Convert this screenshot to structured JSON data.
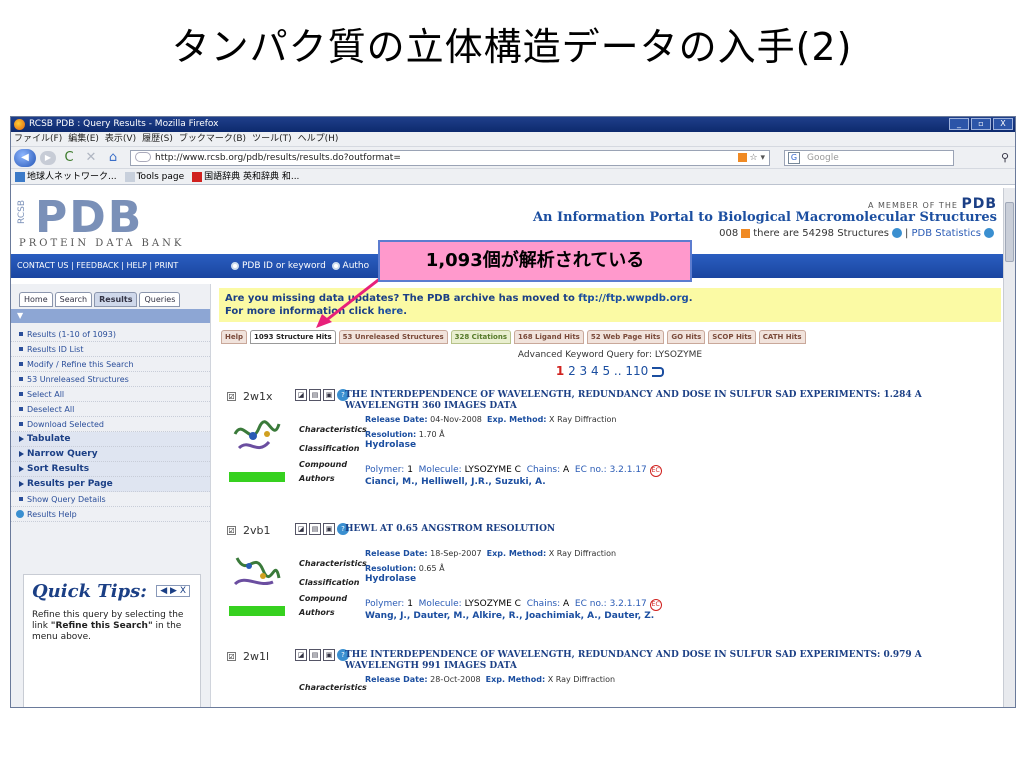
{
  "slide": {
    "title": "タンパク質の立体構造データの入手(2)"
  },
  "browser": {
    "window_title": "RCSB PDB : Query Results - Mozilla Firefox",
    "menu": [
      "ファイル(F)",
      "編集(E)",
      "表示(V)",
      "履歴(S)",
      "ブックマーク(B)",
      "ツール(T)",
      "ヘルプ(H)"
    ],
    "url": "http://www.rcsb.org/pdb/results/results.do?outformat=",
    "search_placeholder": "Google",
    "bookmarks": [
      "地球人ネットワーク...",
      "Tools page",
      "国語辞典 英和辞典 和..."
    ],
    "window_controls": [
      "_",
      "▫",
      "X"
    ]
  },
  "header": {
    "logo_big": "PDB",
    "logo_rcsb": "RCSB",
    "logo_sub": "PROTEIN DATA BANK",
    "member": "A MEMBER OF THE",
    "member_brand": "PDB",
    "portal": "An Information Portal to Biological Macromolecular Structures",
    "stats_date": "008",
    "stats_text": "there are 54298 Structures",
    "stats_sep": "|",
    "stats_link": "PDB Statistics"
  },
  "topnav": {
    "links": "CONTACT US | FEEDBACK | HELP | PRINT",
    "radio1": "PDB ID or keyword",
    "radio2": "Autho"
  },
  "sidebar": {
    "tabs": [
      "Home",
      "Search",
      "Results",
      "Queries"
    ],
    "items": [
      "Results (1-10 of 1093)",
      "Results ID List",
      "Modify / Refine this Search",
      "53 Unreleased Structures",
      "Select All",
      "Deselect All",
      "Download Selected",
      "Tabulate",
      "Narrow Query",
      "Sort Results",
      "Results per Page",
      "Show Query Details",
      "Results Help"
    ],
    "quick_tips_title": "Quick Tips:",
    "quick_tips_nav": "◀ ▶ X",
    "quick_tips_body_1": "Refine this query by selecting the link ",
    "quick_tips_body_bold": "\"Refine this Search\"",
    "quick_tips_body_2": " in the menu above."
  },
  "main": {
    "notice_1": "Are you missing data updates? The PDB archive has moved to ",
    "notice_link": "ftp://ftp.wwpdb.org",
    "notice_2": ".",
    "notice_3": "For more information click ",
    "notice_link2": "here",
    "notice_4": ".",
    "tabs": [
      "Help",
      "1093 Structure Hits",
      "53 Unreleased Structures",
      "328 Citations",
      "168 Ligand Hits",
      "52 Web Page Hits",
      "GO Hits",
      "SCOP Hits",
      "CATH Hits"
    ],
    "query_line": "Advanced Keyword Query for: LYSOZYME",
    "pager_current": "1",
    "pager_rest": "2 3 4 5 .. 110"
  },
  "labels": {
    "characteristics": "Characteristics",
    "classification": "Classification",
    "compound": "Compound",
    "authors": "Authors",
    "release_date": "Release Date:",
    "exp_method": "Exp. Method:",
    "resolution": "Resolution:",
    "polymer": "Polymer:",
    "molecule": "Molecule:",
    "chains": "Chains:",
    "ec_no": "EC no.:"
  },
  "entries": [
    {
      "id": "2w1x",
      "checked": "☑",
      "title": "THE INTERDEPENDENCE OF WAVELENGTH, REDUNDANCY AND DOSE IN SULFUR SAD EXPERIMENTS: 1.284 A WAVELENGTH 360 IMAGES DATA",
      "release_date": "04-Nov-2008",
      "exp_method": "X Ray Diffraction",
      "resolution": "1.70 Å",
      "classification": "Hydrolase",
      "polymer": "1",
      "molecule": "LYSOZYME C",
      "chains": "A",
      "ec": "3.2.1.17",
      "authors": "Cianci, M., Helliwell, J.R., Suzuki, A."
    },
    {
      "id": "2vb1",
      "checked": "☑",
      "title": "HEWL AT 0.65 ANGSTROM RESOLUTION",
      "release_date": "18-Sep-2007",
      "exp_method": "X Ray Diffraction",
      "resolution": "0.65 Å",
      "classification": "Hydrolase",
      "polymer": "1",
      "molecule": "LYSOZYME C",
      "chains": "A",
      "ec": "3.2.1.17",
      "authors": "Wang, J., Dauter, M., Alkire, R., Joachimiak, A., Dauter, Z."
    },
    {
      "id": "2w1l",
      "checked": "☑",
      "title": "THE INTERDEPENDENCE OF WAVELENGTH, REDUNDANCY AND DOSE IN SULFUR SAD EXPERIMENTS: 0.979 A WAVELENGTH 991 IMAGES DATA",
      "release_date": "28-Oct-2008",
      "exp_method": "X Ray Diffraction"
    }
  ],
  "callout": {
    "text": "1,093個が解析されている"
  },
  "colors": {
    "accent": "#1b4ea0",
    "callout_bg": "#ff99cc",
    "notice_bg": "#fbfaa4",
    "bar_green": "#36d11f"
  }
}
